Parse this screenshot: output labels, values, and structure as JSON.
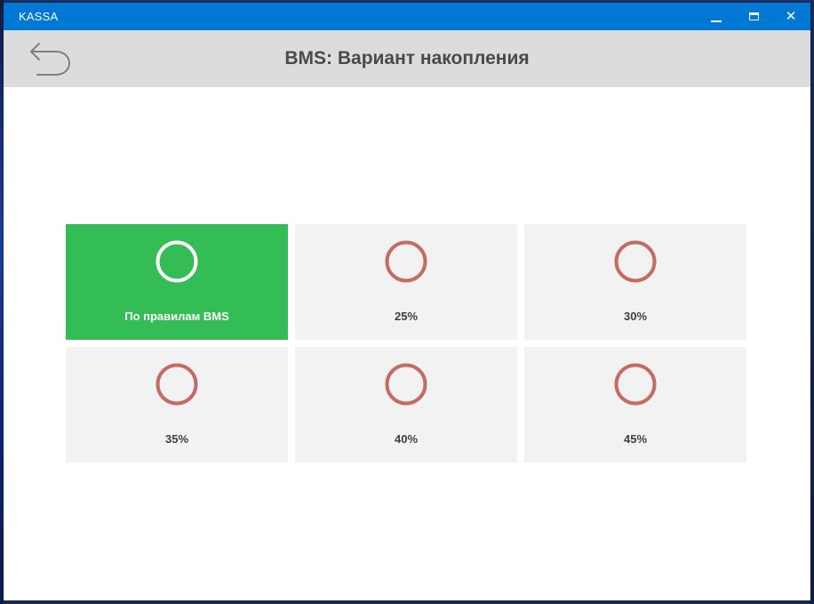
{
  "window": {
    "title": "KASSA",
    "titlebar_color": "#0078d4"
  },
  "header": {
    "title": "BMS: Вариант накопления",
    "back_icon": "back-arrow-icon",
    "background": "#dcdcdc"
  },
  "options": [
    {
      "label": "По правилам BMS",
      "selected": true
    },
    {
      "label": "25%",
      "selected": false
    },
    {
      "label": "30%",
      "selected": false
    },
    {
      "label": "35%",
      "selected": false
    },
    {
      "label": "40%",
      "selected": false
    },
    {
      "label": "45%",
      "selected": false
    }
  ],
  "colors": {
    "selected_tile": "#34bc55",
    "tile": "#f2f2f2",
    "unselected_radio": "#c56b64",
    "selected_radio": "#ffffff"
  }
}
